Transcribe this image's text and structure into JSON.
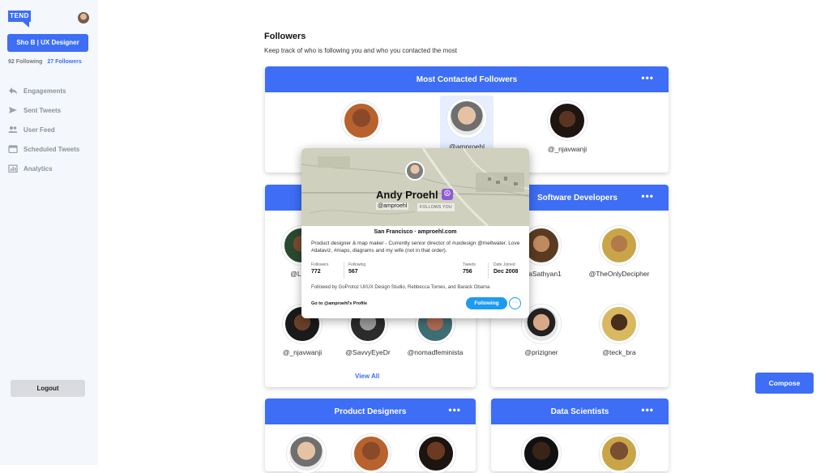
{
  "app": {
    "logo_text": "TEND"
  },
  "sidebar": {
    "user_button": "Sho B | UX Designer",
    "following": "92 Following",
    "followers": "27 Followers",
    "nav": [
      {
        "label": "Engagements",
        "icon": "reply-icon"
      },
      {
        "label": "Sent Tweets",
        "icon": "send-icon"
      },
      {
        "label": "User Feed",
        "icon": "users-icon"
      },
      {
        "label": "Scheduled Tweets",
        "icon": "calendar-icon"
      },
      {
        "label": "Analytics",
        "icon": "analytics-icon"
      }
    ],
    "logout": "Logout"
  },
  "page": {
    "title": "Followers",
    "subtitle": "Keep track of who is following you and who you contacted the most"
  },
  "cards": {
    "most_contacted": {
      "title": "Most Contacted Followers",
      "people": [
        "",
        "@amproehl",
        "@_njavwanji"
      ]
    },
    "left_group": {
      "title": "",
      "people": [
        "@Loho",
        "",
        "",
        "@_njavwanji",
        "@SavvyEyeDr",
        "@nomadfeminista"
      ],
      "view_all": "View All"
    },
    "software_developers": {
      "title": "Software Developers",
      "people": [
        "ayaSathyan1",
        "@TheOnlyDecipher",
        "@prizigner",
        "@teck_bra"
      ]
    },
    "product_designers": {
      "title": "Product Designers"
    },
    "data_scientists": {
      "title": "Data Scientists"
    }
  },
  "compose": "Compose",
  "popup": {
    "name": "Andy Proehl",
    "handle": "@amproehl",
    "follows_you": "FOLLOWS YOU",
    "location": "San Francisco · amproehl.com",
    "bio": "Product designer & map maker - Currently senior director of #uxdesign @meltwater. Love #dataviz, #maps, diagrams and my wife (not in that order).",
    "stats": {
      "followers_label": "Followers",
      "followers": "772",
      "following_label": "Following",
      "following": "567",
      "tweets_label": "Tweets",
      "tweets": "756",
      "joined_label": "Date Joined",
      "joined": "Dec 2008"
    },
    "followed_by": "Followed by GoProtoz UI/UX Design Studio, Rebbecca Tomes, and Barack Obama",
    "goto": "Go to @amproehl's Profile",
    "following_button": "Following",
    "more_button": "···"
  },
  "colors": {
    "accent": "#3d6ef5",
    "twitter_blue": "#1d9bf0",
    "sidebar_bg": "#f4f7fb"
  }
}
